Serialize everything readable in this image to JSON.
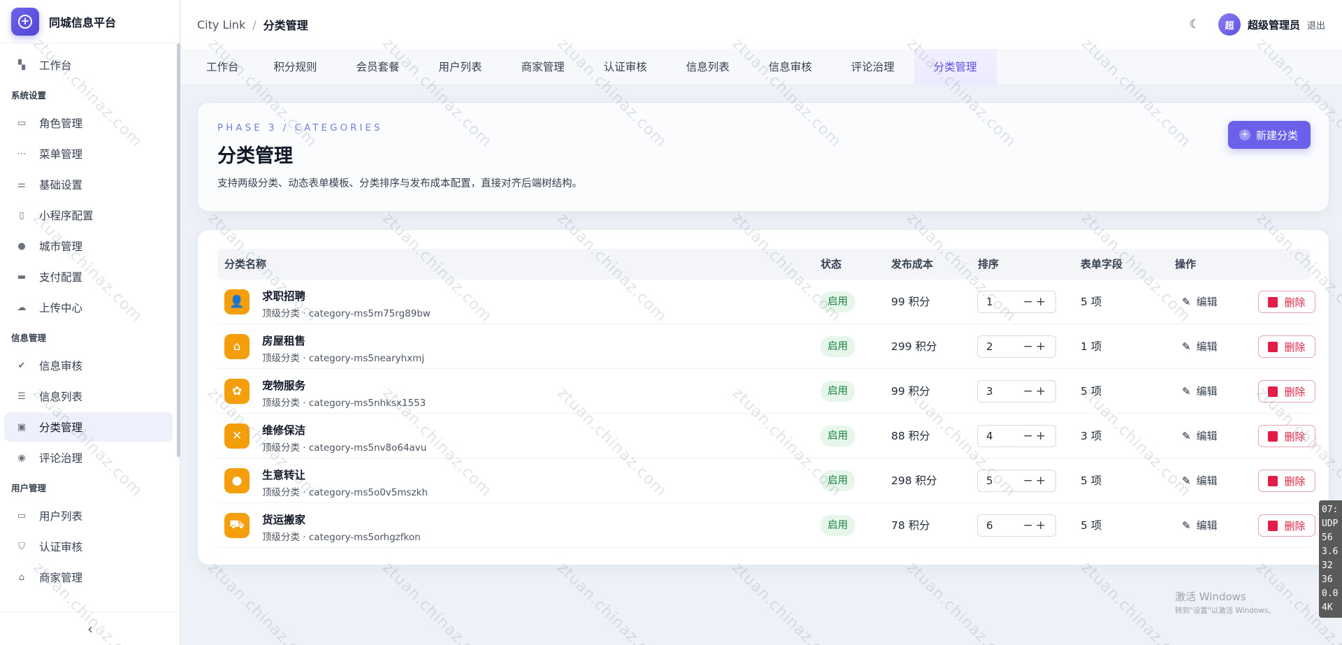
{
  "brand": {
    "title": "同城信息平台"
  },
  "sidebar": {
    "top_item": {
      "label": "工作台",
      "icon": "dashboard-icon"
    },
    "groups": [
      {
        "title": "系统设置",
        "items": [
          {
            "label": "角色管理",
            "icon": "id-card-icon"
          },
          {
            "label": "菜单管理",
            "icon": "dots-icon"
          },
          {
            "label": "基础设置",
            "icon": "sliders-icon"
          },
          {
            "label": "小程序配置",
            "icon": "phone-icon"
          },
          {
            "label": "城市管理",
            "icon": "location-pin-icon"
          },
          {
            "label": "支付配置",
            "icon": "card-icon"
          },
          {
            "label": "上传中心",
            "icon": "upload-icon"
          }
        ]
      },
      {
        "title": "信息管理",
        "items": [
          {
            "label": "信息审核",
            "icon": "clipboard-check-icon"
          },
          {
            "label": "信息列表",
            "icon": "list-icon"
          },
          {
            "label": "分类管理",
            "icon": "folder-icon",
            "active": true
          },
          {
            "label": "评论治理",
            "icon": "comment-icon"
          }
        ]
      },
      {
        "title": "用户管理",
        "items": [
          {
            "label": "用户列表",
            "icon": "users-icon"
          },
          {
            "label": "认证审核",
            "icon": "shield-check-icon"
          },
          {
            "label": "商家管理",
            "icon": "store-icon"
          }
        ]
      }
    ],
    "collapse_glyph": "‹"
  },
  "header": {
    "breadcrumb_root": "City Link",
    "breadcrumb_sep": "/",
    "breadcrumb_current": "分类管理",
    "avatar_text": "超",
    "user_name": "超级管理员",
    "logout_label": "退出"
  },
  "tabs": [
    {
      "label": "工作台"
    },
    {
      "label": "积分规则"
    },
    {
      "label": "会员套餐"
    },
    {
      "label": "用户列表"
    },
    {
      "label": "商家管理"
    },
    {
      "label": "认证审核"
    },
    {
      "label": "信息列表"
    },
    {
      "label": "信息审核"
    },
    {
      "label": "评论治理"
    },
    {
      "label": "分类管理",
      "active": true
    }
  ],
  "hero": {
    "eyebrow": "PHASE 3 / CATEGORIES",
    "title": "分类管理",
    "description": "支持两级分类、动态表单模板、分类排序与发布成本配置，直接对齐后端树结构。",
    "new_button_label": "新建分类"
  },
  "table": {
    "columns": {
      "name": "分类名称",
      "status": "状态",
      "cost": "发布成本",
      "sort": "排序",
      "fields": "表单字段",
      "actions": "操作"
    },
    "edit_label": "编辑",
    "delete_label": "删除",
    "sort_controls": "−+",
    "rows": [
      {
        "name": "求职招聘",
        "sub": "顶级分类 · category-ms5m75rg89bw",
        "status": "启用",
        "cost": "99 积分",
        "sort": "1",
        "fields": "5 项",
        "icon": "briefcase-person-icon",
        "glyph": "👤"
      },
      {
        "name": "房屋租售",
        "sub": "顶级分类 · category-ms5nearyhxmj",
        "status": "启用",
        "cost": "299 积分",
        "sort": "2",
        "fields": "1 项",
        "icon": "house-icon",
        "glyph": "⌂"
      },
      {
        "name": "宠物服务",
        "sub": "顶级分类 · category-ms5nhksx1553",
        "status": "启用",
        "cost": "99 积分",
        "sort": "3",
        "fields": "5 项",
        "icon": "paw-icon",
        "glyph": "✿"
      },
      {
        "name": "维修保洁",
        "sub": "顶级分类 · category-ms5nv8o64avu",
        "status": "启用",
        "cost": "88 积分",
        "sort": "4",
        "fields": "3 项",
        "icon": "tools-icon",
        "glyph": "✕"
      },
      {
        "name": "生意转让",
        "sub": "顶级分类 · category-ms5o0v5mszkh",
        "status": "启用",
        "cost": "298 积分",
        "sort": "5",
        "fields": "5 项",
        "icon": "person-icon",
        "glyph": "●"
      },
      {
        "name": "货运搬家",
        "sub": "顶级分类 · category-ms5orhgzfkon",
        "status": "启用",
        "cost": "78 积分",
        "sort": "6",
        "fields": "5 项",
        "icon": "delivery-icon",
        "glyph": "⛟"
      }
    ]
  },
  "windows_activation": {
    "line1": "激活 Windows",
    "line2": "转到\"设置\"以激活 Windows。"
  },
  "stats_panel": [
    "07:",
    "UDP",
    "56 ",
    "3.6",
    "32 ",
    "36 ",
    "0.0",
    "4K "
  ],
  "watermark_text": "ztuan.chinaz.com",
  "colors": {
    "accent": "#6b60ea",
    "category_icon": "#f59e0b",
    "status_bg": "#e6f6ea",
    "status_text": "#15803d",
    "danger": "#dc2646"
  }
}
